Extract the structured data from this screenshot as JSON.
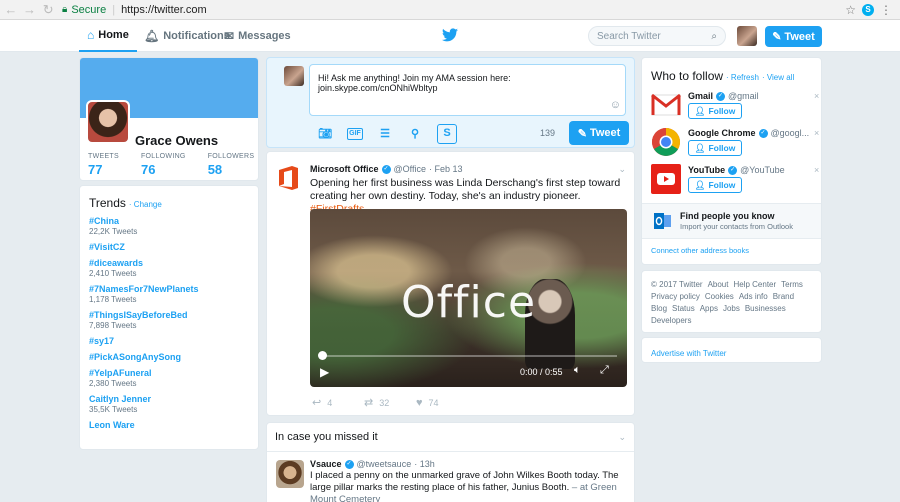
{
  "browser": {
    "secure_label": "Secure",
    "url": "https://twitter.com"
  },
  "nav": {
    "home": "Home",
    "notifications": "Notifications",
    "messages": "Messages",
    "search_placeholder": "Search Twitter",
    "tweet_button": "Tweet"
  },
  "profile": {
    "name": "Grace Owens",
    "stats": [
      {
        "label": "TWEETS",
        "value": "77"
      },
      {
        "label": "FOLLOWING",
        "value": "76"
      },
      {
        "label": "FOLLOWERS",
        "value": "58"
      }
    ]
  },
  "trends": {
    "title": "Trends",
    "change_label": "· Change",
    "items": [
      {
        "name": "#China",
        "sub": "22,2K Tweets"
      },
      {
        "name": "#VisitCZ",
        "sub": ""
      },
      {
        "name": "#diceawards",
        "sub": "2,410 Tweets"
      },
      {
        "name": "#7NamesFor7NewPlanets",
        "sub": "1,178 Tweets"
      },
      {
        "name": "#ThingsISayBeforeBed",
        "sub": "7,898 Tweets"
      },
      {
        "name": "#sy17",
        "sub": ""
      },
      {
        "name": "#PickASongAnySong",
        "sub": ""
      },
      {
        "name": "#YelpAFuneral",
        "sub": "2,380 Tweets"
      },
      {
        "name": "Caitlyn Jenner",
        "sub": "35,5K Tweets"
      },
      {
        "name": "Leon Ware",
        "sub": ""
      }
    ]
  },
  "composer": {
    "text": "Hi! Ask me anything! Join my AMA session here: join.skype.com/cnONhiWbltyp",
    "char_count": "139",
    "tweet_button": "Tweet"
  },
  "tweet": {
    "author": "Microsoft Office",
    "handle": "@Office",
    "date": "· Feb 13",
    "text": "Opening her first business was Linda Derschang's first step toward creating her own destiny. Today, she's an industry pioneer. ",
    "hashtag": "#FirstDrafts",
    "video_title": "Office",
    "video_time": "0:00 / 0:55",
    "replies": "4",
    "retweets": "32",
    "likes": "74"
  },
  "icymi": {
    "title": "In case you missed it",
    "author": "Vsauce",
    "handle": "@tweetsauce",
    "date": "· 13h",
    "text": "I placed a penny on the unmarked grave of John Wilkes Booth today. The large pillar marks the resting place of his father, Junius Booth.",
    "location": " – at Green Mount Cemetery"
  },
  "who_to_follow": {
    "title": "Who to follow",
    "refresh": "· Refresh",
    "view_all": "· View all",
    "follow_label": "Follow",
    "items": [
      {
        "name": "Gmail",
        "handle": "@gmail"
      },
      {
        "name": "Google Chrome",
        "handle": "@googl..."
      },
      {
        "name": "YouTube",
        "handle": "@YouTube"
      }
    ],
    "find_title": "Find people you know",
    "find_sub": "Import your contacts from Outlook",
    "connect": "Connect other address books"
  },
  "footer": {
    "links": [
      "© 2017 Twitter",
      "About",
      "Help Center",
      "Terms",
      "Privacy policy",
      "Cookies",
      "Ads info",
      "Brand",
      "Blog",
      "Status",
      "Apps",
      "Jobs",
      "Businesses",
      "Developers"
    ],
    "advertise": "Advertise with Twitter"
  },
  "colors": {
    "accent": "#1da1f2",
    "banner": "#55acee",
    "background": "#e6ecf0",
    "hashtag": "#e8590c"
  }
}
